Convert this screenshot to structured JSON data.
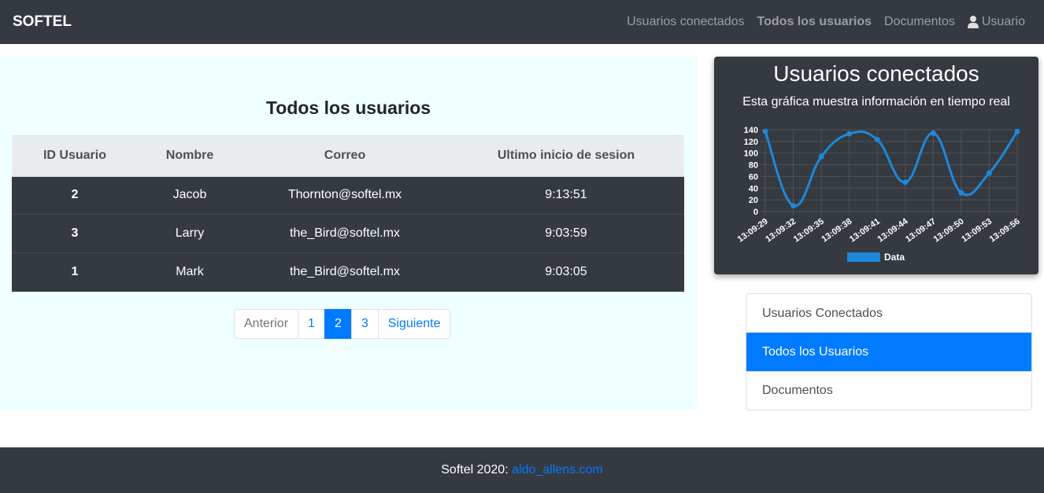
{
  "navbar": {
    "brand": "SOFTEL",
    "links": [
      "Usuarios conectados",
      "Todos los usuarios",
      "Documentos"
    ],
    "user_label": "Usuario",
    "user_icon": "user-icon"
  },
  "main": {
    "title": "Todos los usuarios",
    "table": {
      "headers": [
        "ID Usuario",
        "Nombre",
        "Correo",
        "Ultimo inicio de sesion"
      ],
      "rows": [
        [
          "2",
          "Jacob",
          "Thornton@softel.mx",
          "9:13:51"
        ],
        [
          "3",
          "Larry",
          "the_Bird@softel.mx",
          "9:03:59"
        ],
        [
          "1",
          "Mark",
          "the_Bird@softel.mx",
          "9:03:05"
        ]
      ]
    },
    "pagination": {
      "prev": "Anterior",
      "pages": [
        "1",
        "2",
        "3"
      ],
      "active_page": "2",
      "next": "Siguiente"
    }
  },
  "chart_card": {
    "title": "Usuarios conectados",
    "subtitle": "Esta gráfica muestra información en tiempo real"
  },
  "chart_data": {
    "type": "line",
    "x": [
      "13:09:29",
      "13:09:32",
      "13:09:35",
      "13:09:38",
      "13:09:41",
      "13:09:44",
      "13:09:47",
      "13:09:50",
      "13:09:53",
      "13:09:56"
    ],
    "series": [
      {
        "name": "Data",
        "values": [
          137,
          10,
          94,
          133,
          123,
          50,
          134,
          32,
          66,
          137
        ],
        "color": "#1f88d8"
      }
    ],
    "y_ticks": [
      "0",
      "20",
      "40",
      "60",
      "80",
      "100",
      "120",
      "140"
    ],
    "ylim": [
      0,
      140
    ],
    "grid": true,
    "legend": "bottom"
  },
  "sidebar": {
    "items": [
      "Usuarios Conectados",
      "Todos los Usuarios",
      "Documentos"
    ],
    "active_index": 1
  },
  "footer": {
    "text": "Softel 2020:",
    "link": "aldo_allens.com"
  }
}
